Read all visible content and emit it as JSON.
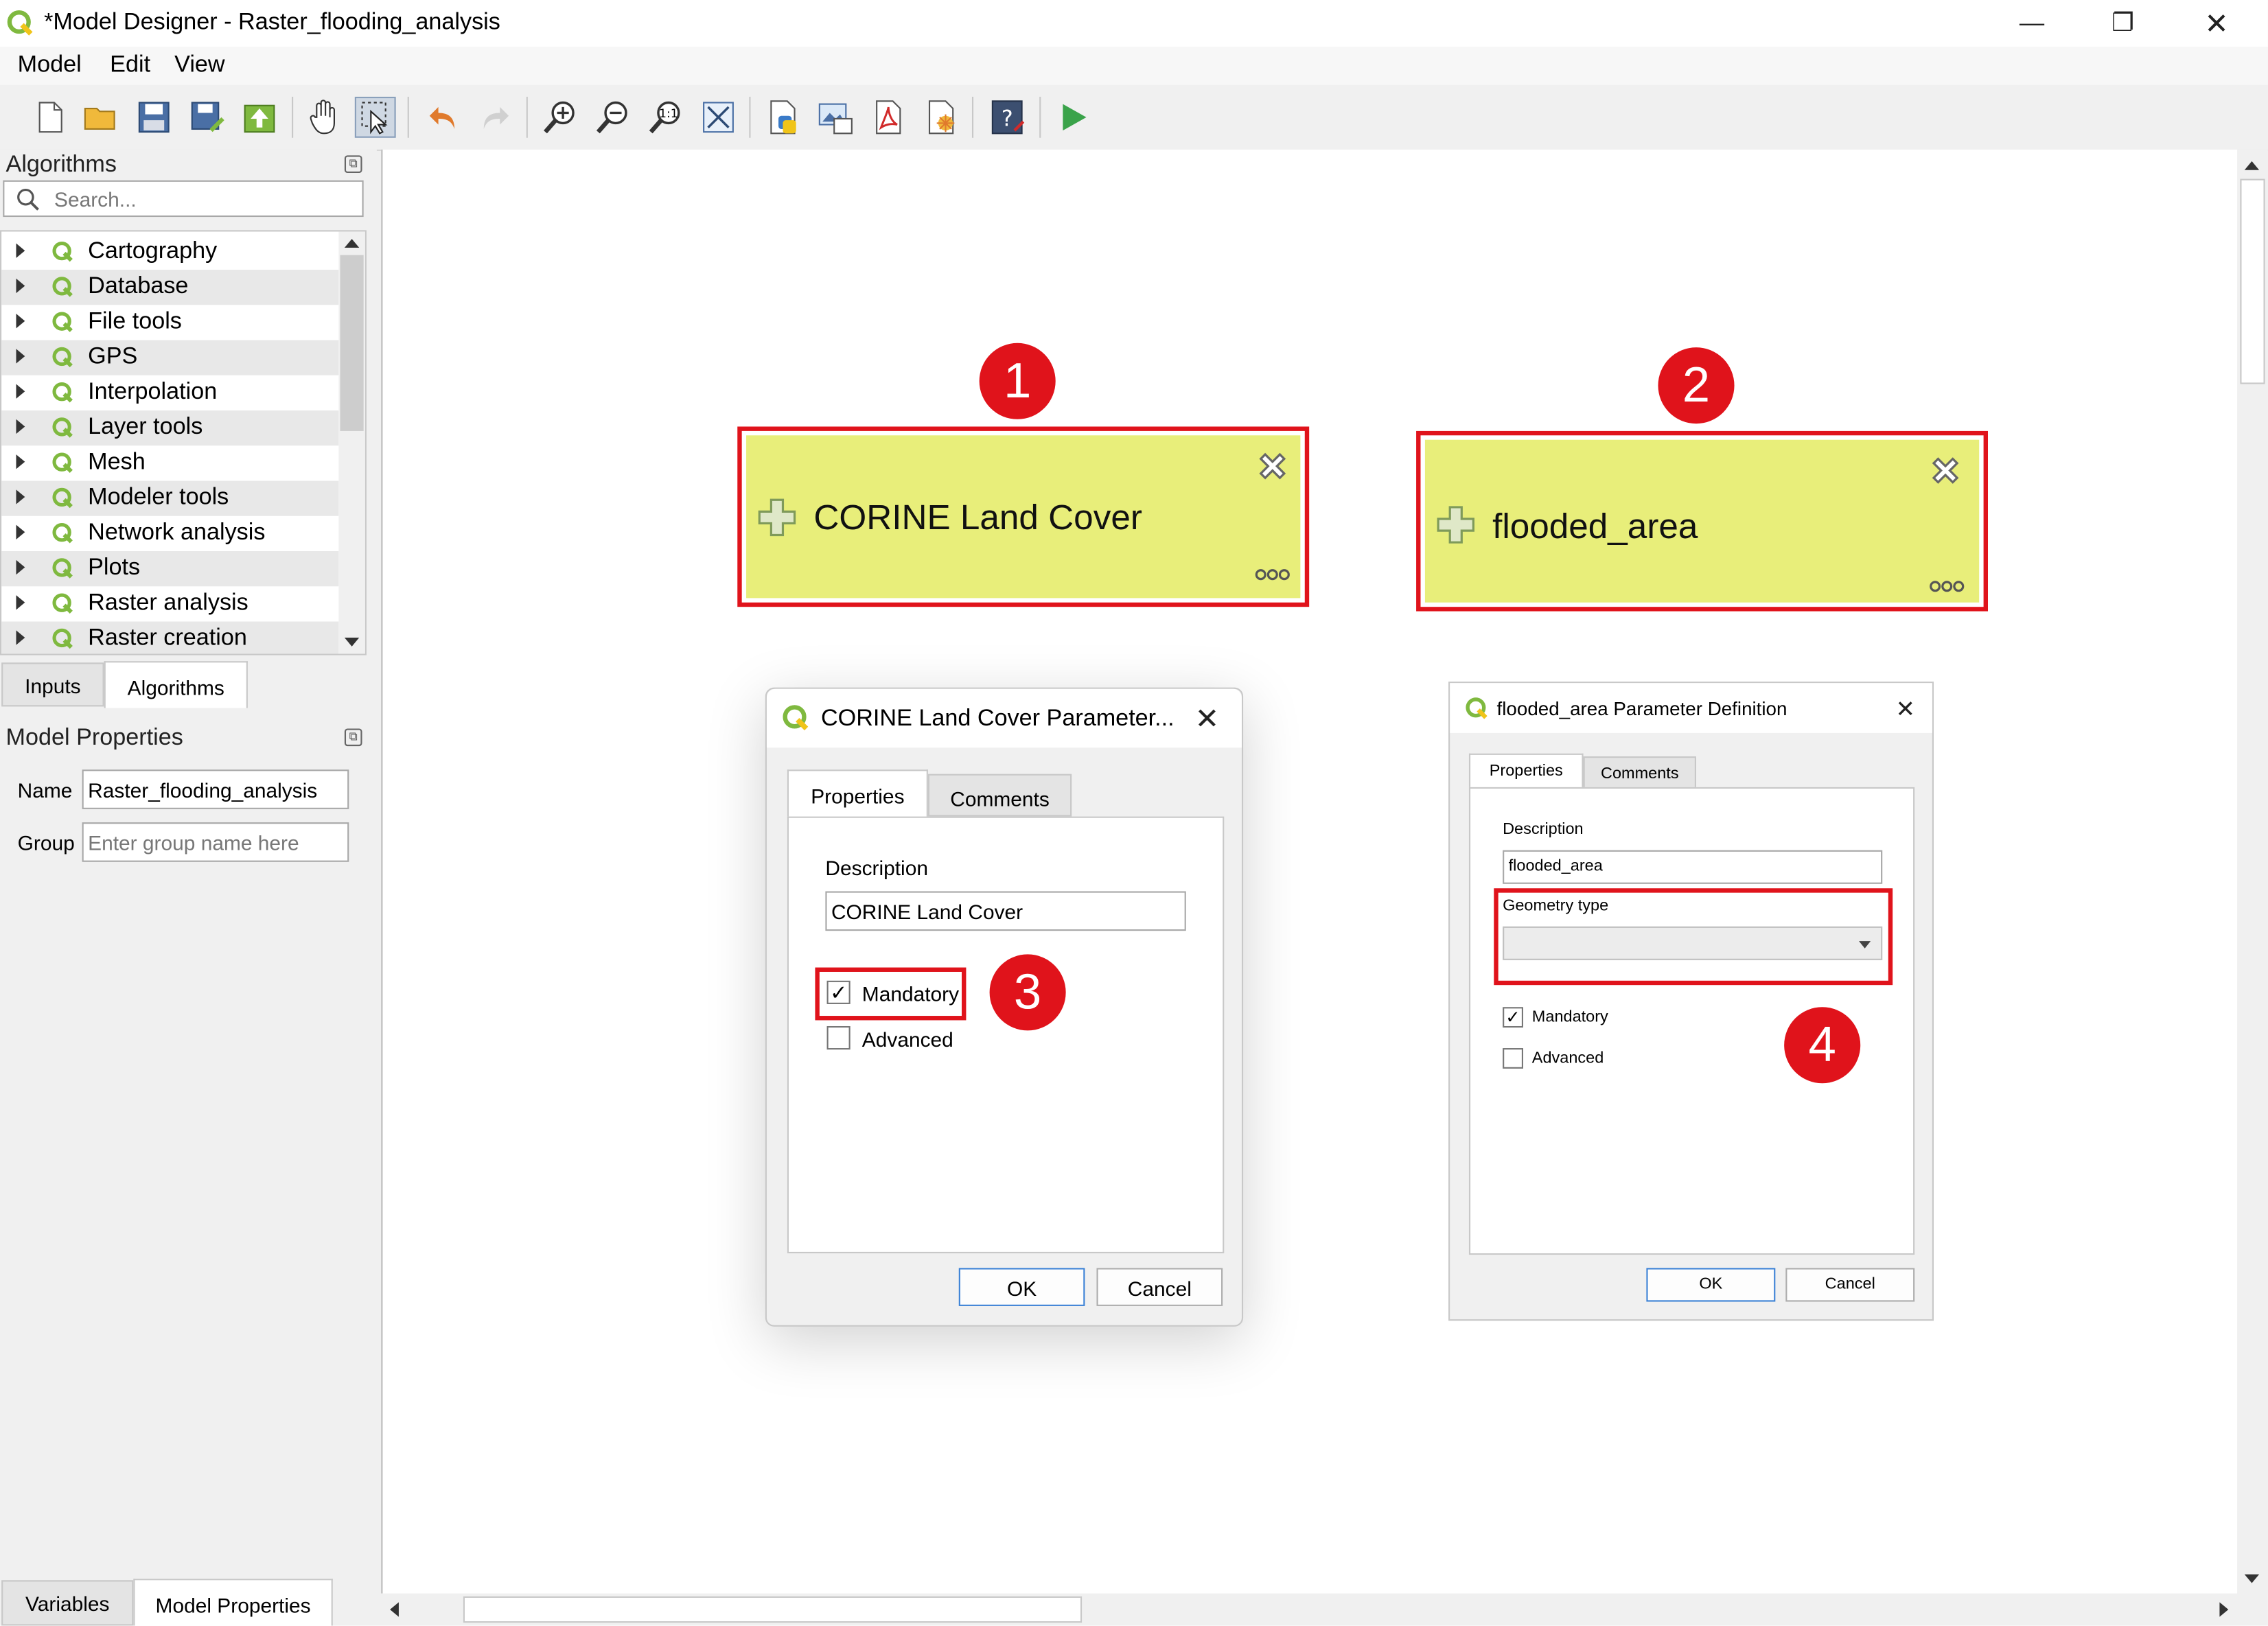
{
  "window": {
    "title": "*Model Designer - Raster_flooding_analysis",
    "minimize_glyph": "—",
    "restore_glyph": "❐",
    "close_glyph": "✕"
  },
  "menu": [
    "Model",
    "Edit",
    "View"
  ],
  "toolbar": {
    "icons": [
      "new-model-icon",
      "open-model-icon",
      "save-icon",
      "save-as-icon",
      "save-in-project-icon",
      "pan-icon",
      "select-icon",
      "undo-icon",
      "redo-icon",
      "zoom-in-icon",
      "zoom-out-icon",
      "zoom-actual-icon",
      "zoom-full-icon",
      "export-python-icon",
      "export-image-icon",
      "export-pdf-icon",
      "export-svg-icon",
      "edit-help-icon",
      "run-model-icon"
    ]
  },
  "algorithms_panel": {
    "title": "Algorithms",
    "search_placeholder": "Search...",
    "groups": [
      "Cartography",
      "Database",
      "File tools",
      "GPS",
      "Interpolation",
      "Layer tools",
      "Mesh",
      "Modeler tools",
      "Network analysis",
      "Plots",
      "Raster analysis",
      "Raster creation"
    ],
    "tabs": [
      "Inputs",
      "Algorithms"
    ]
  },
  "model_properties": {
    "title": "Model Properties",
    "name_label": "Name",
    "name_value": "Raster_flooding_analysis",
    "group_label": "Group",
    "group_placeholder": "Enter group name here"
  },
  "bottom_tabs": [
    "Variables",
    "Model Properties"
  ],
  "canvas": {
    "nodes": [
      {
        "label": "CORINE Land Cover",
        "badge": "1"
      },
      {
        "label": "flooded_area",
        "badge": "2"
      }
    ],
    "badges": [
      "3",
      "4"
    ]
  },
  "dialog_corine": {
    "title": "CORINE Land Cover Parameter...",
    "tabs": [
      "Properties",
      "Comments"
    ],
    "description_label": "Description",
    "description_value": "CORINE Land Cover",
    "mandatory_label": "Mandatory",
    "mandatory_checked": true,
    "advanced_label": "Advanced",
    "advanced_checked": false,
    "ok": "OK",
    "cancel": "Cancel"
  },
  "dialog_flooded": {
    "title": "flooded_area Parameter Definition",
    "tabs": [
      "Properties",
      "Comments"
    ],
    "description_label": "Description",
    "description_value": "flooded_area",
    "geometry_label": "Geometry type",
    "geometry_value": "",
    "mandatory_label": "Mandatory",
    "mandatory_checked": true,
    "advanced_label": "Advanced",
    "advanced_checked": false,
    "ok": "OK",
    "cancel": "Cancel"
  },
  "colors": {
    "node_fill": "#e8ee7a",
    "annotation_red": "#e0131b",
    "qgis_green": "#7fb93f"
  }
}
